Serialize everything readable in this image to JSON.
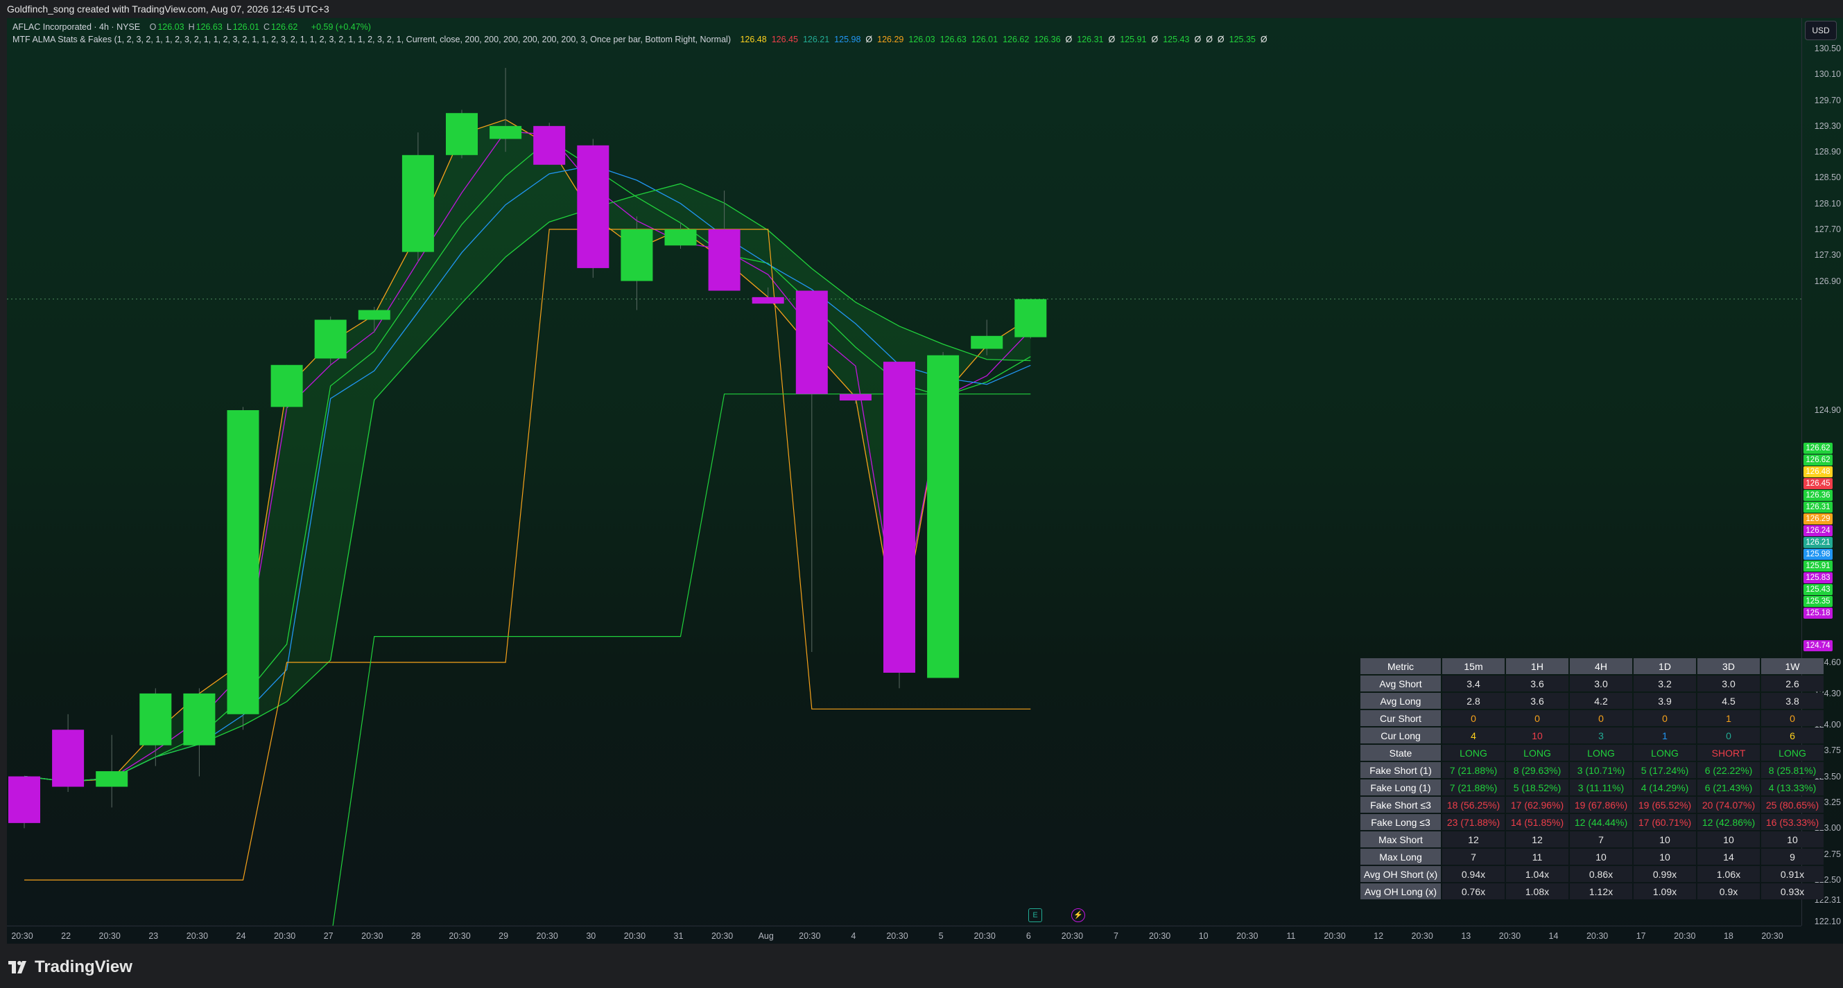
{
  "window": {
    "title": "Goldfinch_song created with TradingView.com, Aug 07, 2026 12:45 UTC+3"
  },
  "legend": {
    "symbol": "AFLAC Incorporated · 4h · NYSE",
    "ohlc": [
      {
        "k": "O",
        "v": "126.03"
      },
      {
        "k": "H",
        "v": "126.63"
      },
      {
        "k": "L",
        "v": "126.01"
      },
      {
        "k": "C",
        "v": "126.62"
      }
    ],
    "change": "+0.59 (+0.47%)",
    "indicator": "MTF ALMA Stats & Fakes (1, 2, 3, 2, 1, 1, 2, 3, 2, 1, 1, 2, 3, 2, 1, 1, 2, 3, 2, 1, 1, 2, 3, 2, 1, 1, 2, 3, 2, 1, Current, close, 200, 200, 200, 200, 200, 200, 3, Once per bar, Bottom Right, Normal)",
    "values": [
      {
        "t": "126.48",
        "c": "#ffd21e"
      },
      {
        "t": "126.45",
        "c": "#ef3e4a"
      },
      {
        "t": "126.21",
        "c": "#22ab94"
      },
      {
        "t": "125.98",
        "c": "#2196f3"
      },
      {
        "t": "Ø",
        "c": "#e6e6e6"
      },
      {
        "t": "126.29",
        "c": "#f7a21b"
      },
      {
        "t": "126.03",
        "c": "#21d23c"
      },
      {
        "t": "126.63",
        "c": "#21d23c"
      },
      {
        "t": "126.01",
        "c": "#21d23c"
      },
      {
        "t": "126.62",
        "c": "#21d23c"
      },
      {
        "t": "126.36",
        "c": "#21d23c"
      },
      {
        "t": "Ø",
        "c": "#e6e6e6"
      },
      {
        "t": "126.31",
        "c": "#21d23c"
      },
      {
        "t": "Ø",
        "c": "#e6e6e6"
      },
      {
        "t": "125.91",
        "c": "#21d23c"
      },
      {
        "t": "Ø",
        "c": "#e6e6e6"
      },
      {
        "t": "125.43",
        "c": "#21d23c"
      },
      {
        "t": "Ø",
        "c": "#e6e6e6"
      },
      {
        "t": "Ø",
        "c": "#e6e6e6"
      },
      {
        "t": "Ø",
        "c": "#e6e6e6"
      },
      {
        "t": "125.35",
        "c": "#21d23c"
      },
      {
        "t": "Ø",
        "c": "#e6e6e6"
      }
    ]
  },
  "price_axis": {
    "currency": "USD",
    "ticks": [
      "130.50",
      "130.10",
      "129.70",
      "129.30",
      "128.90",
      "128.50",
      "128.10",
      "127.70",
      "127.30",
      "126.90",
      "124.90",
      "124.60",
      "124.30",
      "124.00",
      "123.75",
      "123.50",
      "123.25",
      "123.00",
      "122.75",
      "122.50",
      "122.31",
      "122.10"
    ],
    "labels": [
      {
        "v": "126.62",
        "c": "#21d23c"
      },
      {
        "v": "126.62",
        "c": "#21d23c"
      },
      {
        "v": "126.48",
        "c": "#ffd21e"
      },
      {
        "v": "126.45",
        "c": "#ef3e4a"
      },
      {
        "v": "126.36",
        "c": "#21d23c"
      },
      {
        "v": "126.31",
        "c": "#21d23c"
      },
      {
        "v": "126.29",
        "c": "#f7a21b"
      },
      {
        "v": "126.24",
        "c": "#c116de"
      },
      {
        "v": "126.21",
        "c": "#22ab94"
      },
      {
        "v": "125.98",
        "c": "#2196f3"
      },
      {
        "v": "125.91",
        "c": "#21d23c"
      },
      {
        "v": "125.83",
        "c": "#c116de"
      },
      {
        "v": "125.43",
        "c": "#21d23c"
      },
      {
        "v": "125.35",
        "c": "#21d23c"
      },
      {
        "v": "125.18",
        "c": "#c116de"
      },
      {
        "v": "124.74",
        "c": "#c116de"
      }
    ]
  },
  "time_axis": [
    "20:30",
    "22",
    "20:30",
    "23",
    "20:30",
    "24",
    "20:30",
    "27",
    "20:30",
    "28",
    "20:30",
    "29",
    "20:30",
    "30",
    "20:30",
    "31",
    "20:30",
    "Aug",
    "20:30",
    "4",
    "20:30",
    "5",
    "20:30",
    "6",
    "20:30",
    "7",
    "20:30",
    "10",
    "20:30",
    "11",
    "20:30",
    "12",
    "20:30",
    "13",
    "20:30",
    "14",
    "20:30",
    "17",
    "20:30",
    "18",
    "20:30"
  ],
  "chart_data": {
    "type": "candlestick",
    "symbol": "AFLAC Incorporated",
    "timeframe": "4h",
    "exchange": "NYSE",
    "ylim": [
      122.0,
      130.8
    ],
    "candles": [
      {
        "o": 123.05,
        "h": 123.45,
        "l": 123.0,
        "c": 123.5,
        "up": false
      },
      {
        "o": 123.95,
        "h": 124.1,
        "l": 123.35,
        "c": 123.4,
        "up": false
      },
      {
        "o": 123.4,
        "h": 123.9,
        "l": 123.2,
        "c": 123.55,
        "up": true
      },
      {
        "o": 123.8,
        "h": 124.35,
        "l": 123.6,
        "c": 124.3,
        "up": true
      },
      {
        "o": 123.8,
        "h": 124.35,
        "l": 123.5,
        "c": 124.3,
        "up": true
      },
      {
        "o": 124.1,
        "h": 124.95,
        "l": 123.95,
        "c": 124.9,
        "up": true
      },
      {
        "o": 124.95,
        "h": 125.6,
        "l": 124.9,
        "c": 125.6,
        "up": true
      },
      {
        "o": 125.7,
        "h": 126.35,
        "l": 125.6,
        "c": 126.3,
        "up": true
      },
      {
        "o": 126.3,
        "h": 126.5,
        "l": 126.1,
        "c": 126.45,
        "up": true
      },
      {
        "o": 127.35,
        "h": 129.2,
        "l": 127.2,
        "c": 128.85,
        "up": true
      },
      {
        "o": 128.85,
        "h": 129.55,
        "l": 128.8,
        "c": 129.5,
        "up": true
      },
      {
        "o": 129.1,
        "h": 130.2,
        "l": 128.9,
        "c": 129.3,
        "up": true
      },
      {
        "o": 129.3,
        "h": 129.35,
        "l": 128.7,
        "c": 128.7,
        "up": false
      },
      {
        "o": 129.0,
        "h": 129.1,
        "l": 126.95,
        "c": 127.1,
        "up": false
      },
      {
        "o": 126.9,
        "h": 127.9,
        "l": 126.45,
        "c": 127.7,
        "up": true
      },
      {
        "o": 127.45,
        "h": 127.8,
        "l": 127.4,
        "c": 127.7,
        "up": true
      },
      {
        "o": 127.7,
        "h": 128.3,
        "l": 126.75,
        "c": 126.75,
        "up": false
      },
      {
        "o": 126.65,
        "h": 126.8,
        "l": 126.55,
        "c": 126.55,
        "up": false
      },
      {
        "o": 126.75,
        "h": 126.75,
        "l": 124.7,
        "c": 125.15,
        "up": false
      },
      {
        "o": 125.15,
        "h": 125.15,
        "l": 125.0,
        "c": 125.05,
        "up": false
      },
      {
        "o": 125.65,
        "h": 125.65,
        "l": 124.35,
        "c": 124.5,
        "up": false
      },
      {
        "o": 124.45,
        "h": 125.8,
        "l": 124.45,
        "c": 125.75,
        "up": true
      },
      {
        "o": 125.85,
        "h": 126.3,
        "l": 125.75,
        "c": 126.05,
        "up": true
      },
      {
        "o": 126.03,
        "h": 126.63,
        "l": 126.01,
        "c": 126.62,
        "up": true
      }
    ]
  },
  "stats_table": {
    "header": [
      "Metric",
      "15m",
      "1H",
      "4H",
      "1D",
      "3D",
      "1W"
    ],
    "rows": [
      {
        "m": "Avg Short",
        "cls": "c-num",
        "v": [
          "3.4",
          "3.6",
          "3.0",
          "3.2",
          "3.0",
          "2.6"
        ]
      },
      {
        "m": "Avg Long",
        "cls": "c-num",
        "v": [
          "2.8",
          "3.6",
          "4.2",
          "3.9",
          "4.5",
          "3.8"
        ]
      },
      {
        "m": "Cur Short",
        "cls": "c-orange",
        "v": [
          "0",
          "0",
          "0",
          "0",
          "1",
          "0"
        ]
      },
      {
        "m": "Cur Long",
        "cls": "mixed",
        "v": [
          "4",
          "10",
          "3",
          "1",
          "0",
          "6"
        ],
        "c": [
          "c-yellow",
          "c-red",
          "c-teal",
          "c-blue",
          "c-teal",
          "c-yellow"
        ]
      },
      {
        "m": "State",
        "cls": "mixed",
        "v": [
          "LONG",
          "LONG",
          "LONG",
          "LONG",
          "SHORT",
          "LONG"
        ],
        "c": [
          "c-green",
          "c-green",
          "c-green",
          "c-green",
          "c-red",
          "c-green"
        ]
      },
      {
        "m": "Fake Short (1)",
        "cls": "c-green",
        "v": [
          "7 (21.88%)",
          "8 (29.63%)",
          "3 (10.71%)",
          "5 (17.24%)",
          "6 (22.22%)",
          "8 (25.81%)"
        ]
      },
      {
        "m": "Fake Long (1)",
        "cls": "c-green",
        "v": [
          "7 (21.88%)",
          "5 (18.52%)",
          "3 (11.11%)",
          "4 (14.29%)",
          "6 (21.43%)",
          "4 (13.33%)"
        ]
      },
      {
        "m": "Fake Short ≤3",
        "cls": "c-red",
        "v": [
          "18 (56.25%)",
          "17 (62.96%)",
          "19 (67.86%)",
          "19 (65.52%)",
          "20 (74.07%)",
          "25 (80.65%)"
        ]
      },
      {
        "m": "Fake Long ≤3",
        "cls": "mixed",
        "v": [
          "23 (71.88%)",
          "14 (51.85%)",
          "12 (44.44%)",
          "17 (60.71%)",
          "12 (42.86%)",
          "16 (53.33%)"
        ],
        "c": [
          "c-red",
          "c-red",
          "c-green",
          "c-red",
          "c-green",
          "c-red"
        ]
      },
      {
        "m": "Max Short",
        "cls": "c-num",
        "v": [
          "12",
          "12",
          "7",
          "10",
          "10",
          "10"
        ]
      },
      {
        "m": "Max Long",
        "cls": "c-num",
        "v": [
          "7",
          "11",
          "10",
          "10",
          "14",
          "9"
        ]
      },
      {
        "m": "Avg OH Short (x)",
        "cls": "c-num",
        "v": [
          "0.94x",
          "1.04x",
          "0.86x",
          "0.99x",
          "1.06x",
          "0.91x"
        ]
      },
      {
        "m": "Avg OH Long (x)",
        "cls": "c-num",
        "v": [
          "0.76x",
          "1.08x",
          "1.12x",
          "1.09x",
          "0.9x",
          "0.93x"
        ]
      }
    ]
  },
  "colors": {
    "up": "#21d23c",
    "down": "#c116de",
    "background": "#0b2519"
  },
  "branding": {
    "logo_text": "TradingView"
  },
  "icons": {
    "earnings": "E",
    "dividends": "⚡"
  }
}
